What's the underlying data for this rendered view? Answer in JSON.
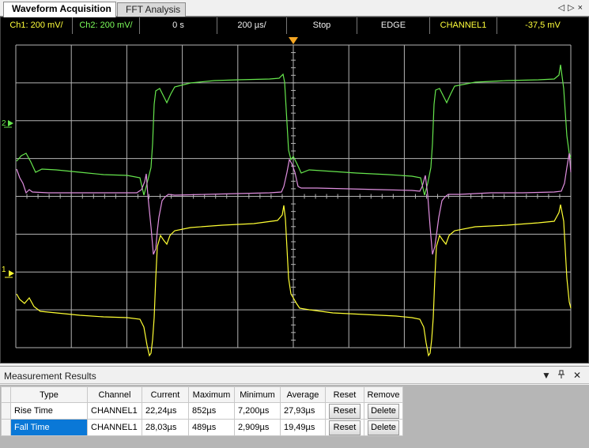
{
  "tabs": [
    {
      "label": "Waveform Acquisition",
      "active": true
    },
    {
      "label": "FFT Analysis",
      "active": false
    }
  ],
  "tab_nav": {
    "prev_icon": "◁",
    "next_icon": "▷",
    "close_icon": "×"
  },
  "status_bar": {
    "ch1": "Ch1: 200 mV/",
    "ch2": "Ch2: 200 mV/",
    "time_offset": "0 s",
    "timebase": "200 µs/",
    "run_state": "Stop",
    "trigger_type": "EDGE",
    "trigger_source": "CHANNEL1",
    "trigger_level": "-37,5 mV"
  },
  "scope": {
    "ch2_marker": "2",
    "ch1_marker": "1",
    "colors": {
      "background": "#000000",
      "grid": "#b4b4b4",
      "ch1": "#ffff33",
      "ch2": "#66e64d",
      "math": "#e08fe0",
      "trigger_marker": "#f5a623"
    }
  },
  "measurements": {
    "title": "Measurement Results",
    "controls": {
      "dropdown_icon": "▼",
      "pin_icon": "pin",
      "close_icon": "✕"
    },
    "columns": [
      "Type",
      "Channel",
      "Current",
      "Maximum",
      "Minimum",
      "Average",
      "Reset",
      "Remove"
    ],
    "rows": [
      {
        "type": "Rise Time",
        "channel": "CHANNEL1",
        "current": "22,24µs",
        "maximum": "852µs",
        "minimum": "7,200µs",
        "average": "27,93µs",
        "reset": "Reset",
        "remove": "Delete",
        "selected": false
      },
      {
        "type": "Fall Time",
        "channel": "CHANNEL1",
        "current": "28,03µs",
        "maximum": "489µs",
        "minimum": "2,909µs",
        "average": "19,49µs",
        "reset": "Reset",
        "remove": "Delete",
        "selected": true
      }
    ]
  }
}
